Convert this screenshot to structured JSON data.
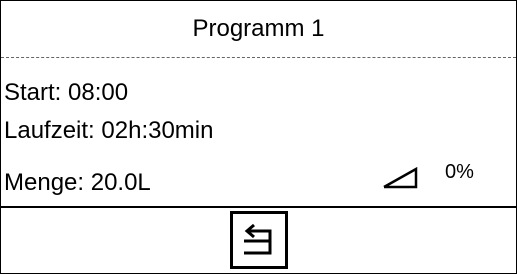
{
  "header": {
    "title": "Programm 1"
  },
  "details": {
    "start": "Start: 08:00",
    "laufzeit": "Laufzeit: 02h:30min",
    "menge": "Menge: 20.0L",
    "ramp_percent": "0%"
  },
  "footer": {
    "back_icon": "back-arrow-icon"
  }
}
